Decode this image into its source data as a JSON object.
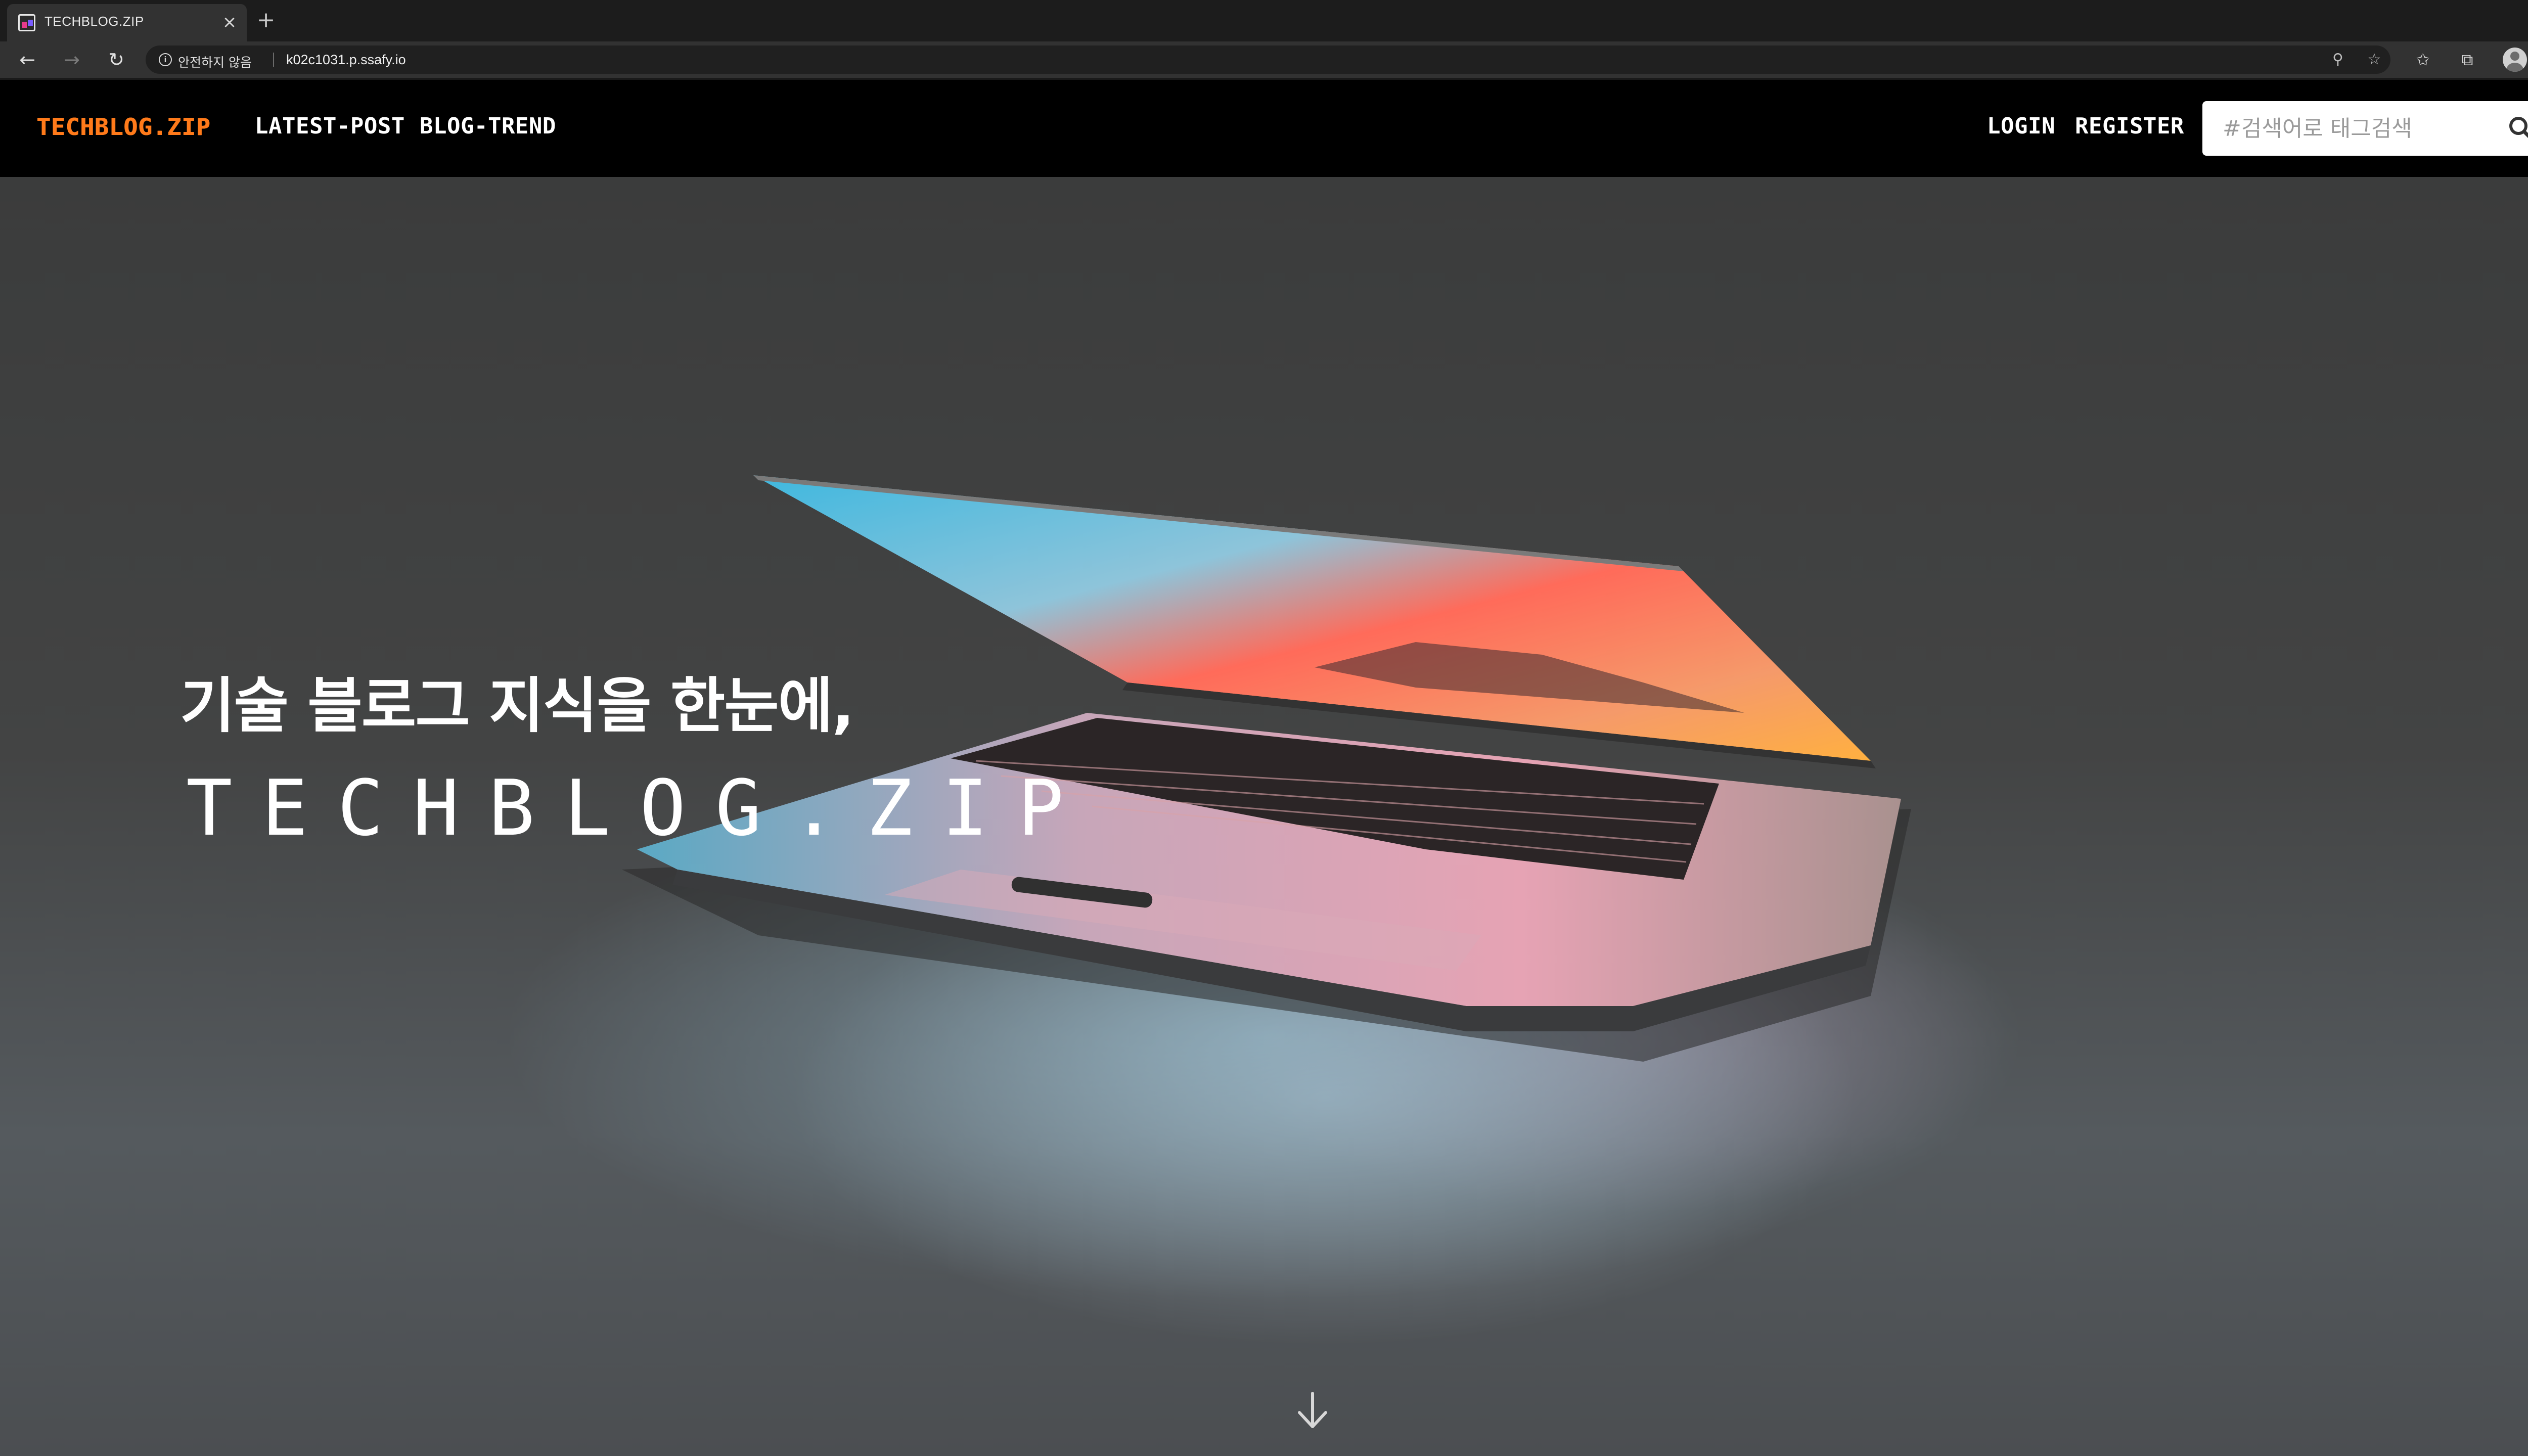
{
  "browser": {
    "tab_title": "TECHBLOG.ZIP",
    "tab_close": "×",
    "new_tab": "+",
    "security_label": "안전하지 않음",
    "url": "k02c1031.p.ssafy.io"
  },
  "icons": {
    "back": "←",
    "forward": "→",
    "reload": "↻",
    "info": "i",
    "zoom": "⚲",
    "favorite": "☆",
    "favorites_bar": "✩",
    "collections": "⧉",
    "more": "···"
  },
  "nav": {
    "brand": "TECHBLOG.ZIP",
    "links": [
      "LATEST-POST",
      "BLOG-TREND"
    ],
    "login": "LOGIN",
    "register": "REGISTER",
    "search_placeholder": "#검색어로 태그검색"
  },
  "hero": {
    "heading": "기술 블로그 지식을 한눈에,",
    "wordmark": "TECHBLOG.ZIP"
  },
  "colors": {
    "brand_orange": "#ff7a1a",
    "navbar_bg": "#000000",
    "chrome_bg": "#323232"
  }
}
